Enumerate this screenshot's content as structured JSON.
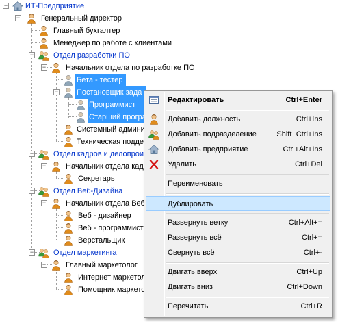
{
  "tree": {
    "root": "ИТ-Предприятие",
    "nodes": [
      "Генеральный директор",
      "Главный бухгалтер",
      "Менеджер по работе с клиентами",
      "Отдел разработки ПО",
      "Начальник отдела по разработке ПО",
      "Бета - тестер",
      "Постановщик зада",
      "Программист",
      "Старший програ",
      "Системный админи",
      "Техническая подде",
      "Отдел кадров и делопрои",
      "Начальник отдела кадр",
      "Секретарь",
      "Отдел Веб-Дизайна",
      "Начальник отдела Веб",
      "Веб - дизайнер",
      "Веб - программист",
      "Верстальщик",
      "Отдел маркетинга",
      "Главный маркетолог",
      "Интернет маркетол",
      "Помощник маркето"
    ]
  },
  "menu": {
    "items": [
      {
        "label": "Редактировать",
        "shortcut": "Ctrl+Enter",
        "icon": "edit-form-icon"
      },
      {
        "label": "Добавить должность",
        "shortcut": "Ctrl+Ins",
        "icon": "add-person-icon"
      },
      {
        "label": "Добавить подразделение",
        "shortcut": "Shift+Ctrl+Ins",
        "icon": "add-group-icon"
      },
      {
        "label": "Добавить предприятие",
        "shortcut": "Ctrl+Alt+Ins",
        "icon": "add-company-icon"
      },
      {
        "label": "Удалить",
        "shortcut": "Ctrl+Del",
        "icon": "delete-x-icon"
      },
      {
        "label": "Переименовать",
        "shortcut": ""
      },
      {
        "label": "Дублировать",
        "shortcut": ""
      },
      {
        "label": "Развернуть ветку",
        "shortcut": "Ctrl+Alt+="
      },
      {
        "label": "Развернуть всё",
        "shortcut": "Ctrl+="
      },
      {
        "label": "Свернуть всё",
        "shortcut": "Ctrl+-"
      },
      {
        "label": "Двигать вверх",
        "shortcut": "Ctrl+Up"
      },
      {
        "label": "Двигать вниз",
        "shortcut": "Ctrl+Down"
      },
      {
        "label": "Перечитать",
        "shortcut": "Ctrl+R"
      }
    ]
  },
  "colors": {
    "link": "#0033cc",
    "selection": "#3399ff",
    "menu_hover": "#cde8ff"
  }
}
